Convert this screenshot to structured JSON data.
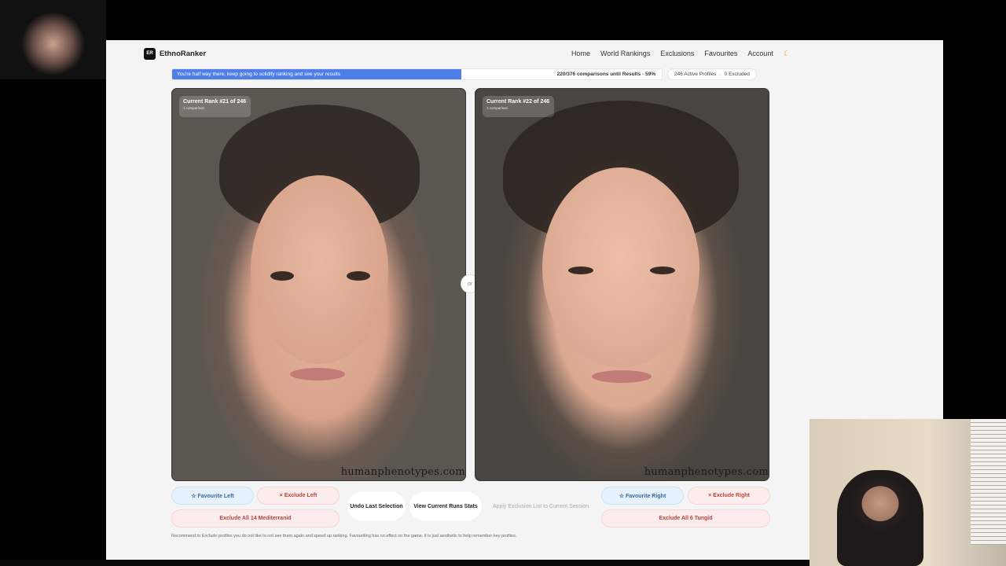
{
  "app": {
    "logo_mark": "ER",
    "name": "EthnoRanker"
  },
  "nav": {
    "items": [
      "Home",
      "World Rankings",
      "Exclusions",
      "Favourites",
      "Account"
    ],
    "theme_icon": "moon-icon"
  },
  "progress": {
    "message": "You're half way there, keep going to solidify ranking and see your results",
    "count_text": "220/376 comparisons until Results · 59%",
    "percent": 59,
    "fill_color": "#4f7ee8"
  },
  "profiles": {
    "active": "246 Active Profiles",
    "excluded": "0 Excluded"
  },
  "left_card": {
    "rank": "Current Rank #21 of 246",
    "sub": "1 comparison",
    "watermark": "humanphenotypes.com"
  },
  "right_card": {
    "rank": "Current Rank #22 of 246",
    "sub": "1 comparison",
    "watermark": "humanphenotypes.com"
  },
  "or_label": "or",
  "buttons": {
    "favourite_left": "☆ Favourite Left",
    "exclude_left": "× Exclude Left",
    "undo": "Undo Last Selection",
    "view_stats": "View Current Runs Stats",
    "apply_exclusion": "Apply Exclusion List to Current Session",
    "favourite_right": "☆ Favourite Right",
    "exclude_right": "× Exclude Right",
    "exclude_all_left": "Exclude All 14 Mediterranid",
    "exclude_all_right": "Exclude All 6 Tungid"
  },
  "footnote": "Recommend to Exclude profiles you do not like to not see them again and speed up ranking. Favouriting has no effect on the game, it is just aesthetic to help remember key profiles."
}
